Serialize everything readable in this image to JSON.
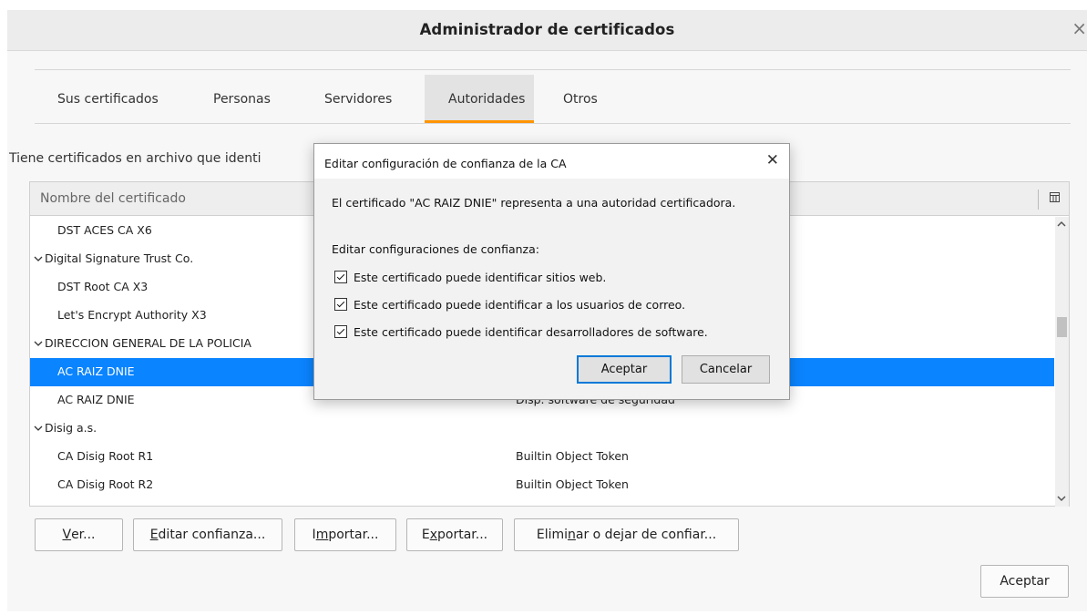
{
  "window": {
    "title": "Administrador de certificados",
    "close_glyph": "×"
  },
  "tabs": [
    {
      "label": "Sus certificados"
    },
    {
      "label": "Personas"
    },
    {
      "label": "Servidores"
    },
    {
      "label": "Autoridades",
      "active": true
    },
    {
      "label": "Otros"
    }
  ],
  "info_text": "Tiene certificados en archivo que identi",
  "table": {
    "header_name": "Nombre del certificado",
    "rows": [
      {
        "type": "child",
        "name": "DST ACES CA X6",
        "device": ""
      },
      {
        "type": "group",
        "name": "Digital Signature Trust Co.",
        "device": ""
      },
      {
        "type": "child",
        "name": "DST Root CA X3",
        "device": ""
      },
      {
        "type": "child",
        "name": "Let's Encrypt Authority X3",
        "device": ""
      },
      {
        "type": "group",
        "name": "DIRECCION GENERAL DE LA POLICIA",
        "device": ""
      },
      {
        "type": "child",
        "name": "AC RAIZ DNIE",
        "device": "",
        "selected": true
      },
      {
        "type": "child",
        "name": "AC RAIZ DNIE",
        "device": "Disp. software de seguridad"
      },
      {
        "type": "group",
        "name": "Disig a.s.",
        "device": ""
      },
      {
        "type": "child",
        "name": "CA Disig Root R1",
        "device": "Builtin Object Token"
      },
      {
        "type": "child",
        "name": "CA Disig Root R2",
        "device": "Builtin Object Token"
      }
    ]
  },
  "buttons": {
    "ver": {
      "mnemonic": "V",
      "rest": "er..."
    },
    "editar": {
      "mnemonic": "E",
      "rest": "ditar confianza..."
    },
    "importar": {
      "pre": "I",
      "mnemonic": "m",
      "rest": "portar..."
    },
    "exportar": {
      "pre": "E",
      "mnemonic": "x",
      "rest": "portar..."
    },
    "eliminar": {
      "pre": "Elimi",
      "mnemonic": "n",
      "rest": "ar o dejar de confiar..."
    },
    "aceptar": "Aceptar"
  },
  "dialog": {
    "title": "Editar configuración de confianza de la CA",
    "close_glyph": "✕",
    "description": "El certificado \"AC RAIZ DNIE\" representa a una autoridad certificadora.",
    "section_label": "Editar configuraciones de confianza:",
    "checkboxes": [
      {
        "label": "Este certificado puede identificar sitios web.",
        "checked": true
      },
      {
        "label": "Este certificado puede identificar a los usuarios de correo.",
        "checked": true
      },
      {
        "label": "Este certificado puede identificar desarrolladores de software.",
        "checked": true
      }
    ],
    "ok_label": "Aceptar",
    "cancel_label": "Cancelar"
  },
  "icons": {
    "column_picker": "column-picker-icon",
    "scroll_up": "chevron-up-icon",
    "scroll_down": "chevron-down-icon",
    "expander": "chevron-down-icon"
  },
  "colors": {
    "accent_tab": "#ff9500",
    "selection": "#0a84ff",
    "dialog_default_border": "#0078d7"
  }
}
